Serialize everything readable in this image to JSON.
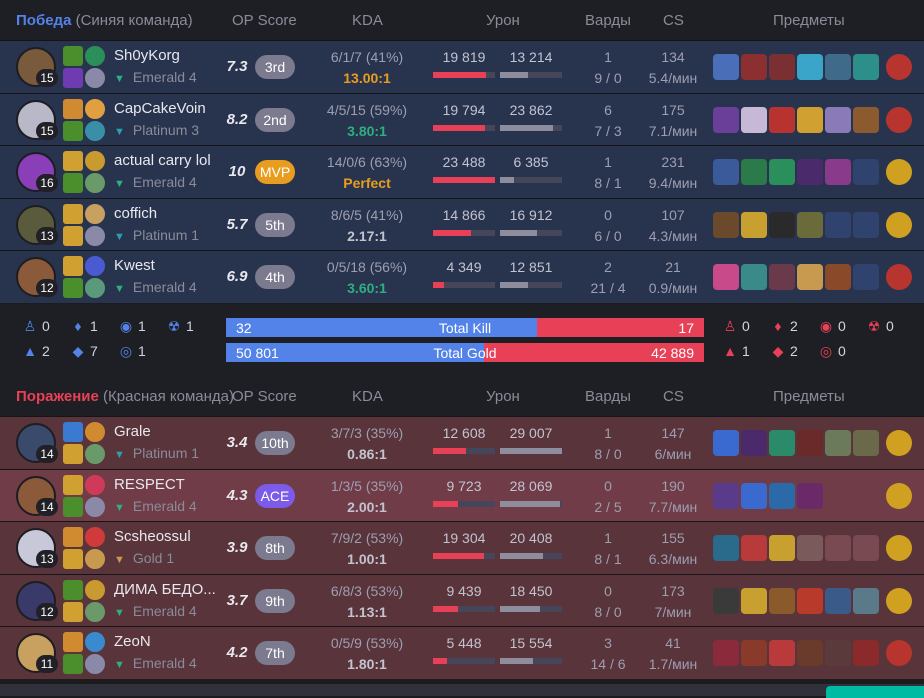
{
  "blue_team": {
    "result": "Победа",
    "side": "(Синяя команда)",
    "headers": {
      "op": "OP Score",
      "kda": "KDA",
      "damage": "Урон",
      "wards": "Варды",
      "cs": "CS",
      "items": "Предметы"
    },
    "players": [
      {
        "name": "Sh0yKorg",
        "tier": "Emerald 4",
        "tier_color": "#2daf7f",
        "level": "15",
        "op": "7.3",
        "rank": "3rd",
        "rank_type": "normal",
        "kda_line": "6/1/7 (41%)",
        "kda_ratio": "13.00:1",
        "kda_color": "#e89d20",
        "dmg_dealt": "19 819",
        "dmg_taken": "13 214",
        "dmg_dealt_frac": 0.85,
        "dmg_taken_frac": 0.45,
        "wards_placed": "1",
        "wards_kills": "9 / 0",
        "cs": "134",
        "cs_min": "5.4/мин",
        "champ_color": "#7a5a3c",
        "spells": [
          "#4a8f2b",
          "#6e3bb0"
        ],
        "runes": [
          "#2b8f5a",
          "#8a8aa8"
        ],
        "items": [
          "#4a6fb8",
          "#8b2f30",
          "#7a3033",
          "#3aa5c8",
          "#3f6a8a",
          "#2d8f8a"
        ],
        "ward_color": "#b8342f"
      },
      {
        "name": "CapCakeVoin",
        "tier": "Platinum 3",
        "tier_color": "#2d9fa8",
        "level": "15",
        "op": "8.2",
        "rank": "2nd",
        "rank_type": "normal",
        "kda_line": "4/5/15 (59%)",
        "kda_ratio": "3.80:1",
        "kda_color": "#2daf7f",
        "dmg_dealt": "19 794",
        "dmg_taken": "23 862",
        "dmg_dealt_frac": 0.84,
        "dmg_taken_frac": 0.85,
        "wards_placed": "6",
        "wards_kills": "7 / 3",
        "cs": "175",
        "cs_min": "7.1/мин",
        "champ_color": "#b8b8c8",
        "spells": [
          "#d08a30",
          "#4a8f2b"
        ],
        "runes": [
          "#e0a040",
          "#3a8fa8"
        ],
        "items": [
          "#6a3f9a",
          "#c7b8d8",
          "#b8322f",
          "#d0a030",
          "#8a7ab8",
          "#8b5a2f"
        ],
        "ward_color": "#b8342f"
      },
      {
        "name": "actual carry lol",
        "tier": "Emerald 4",
        "tier_color": "#2daf7f",
        "level": "16",
        "op": "10",
        "rank": "MVP",
        "rank_type": "mvp",
        "kda_line": "14/0/6 (63%)",
        "kda_ratio": "Perfect",
        "kda_color": "#e89d20",
        "dmg_dealt": "23 488",
        "dmg_taken": "6 385",
        "dmg_dealt_frac": 1.0,
        "dmg_taken_frac": 0.22,
        "wards_placed": "1",
        "wards_kills": "8 / 1",
        "cs": "231",
        "cs_min": "9.4/мин",
        "champ_color": "#8a3fb8",
        "spells": [
          "#d0a030",
          "#4a8f2b"
        ],
        "runes": [
          "#c89a30",
          "#6a9a6a"
        ],
        "items": [
          "#3a5a9a",
          "#2a7a4a",
          "#2a8f5a",
          "#4a2a6a",
          "#8a3a8a",
          "empty"
        ],
        "ward_color": "#d0a020"
      },
      {
        "name": "coffich",
        "tier": "Platinum 1",
        "tier_color": "#2d9fa8",
        "level": "13",
        "op": "5.7",
        "rank": "5th",
        "rank_type": "normal",
        "kda_line": "8/6/5 (41%)",
        "kda_ratio": "2.17:1",
        "kda_color": "#c3c3d0",
        "dmg_dealt": "14 866",
        "dmg_taken": "16 912",
        "dmg_dealt_frac": 0.62,
        "dmg_taken_frac": 0.6,
        "wards_placed": "0",
        "wards_kills": "6 / 0",
        "cs": "107",
        "cs_min": "4.3/мин",
        "champ_color": "#5a5a3c",
        "spells": [
          "#d0a030",
          "#d0a030"
        ],
        "runes": [
          "#c8a060",
          "#8a8aa8"
        ],
        "items": [
          "#6a4a2a",
          "#c8a030",
          "#2a2a2a",
          "#6a6a3a",
          "empty",
          "empty"
        ],
        "ward_color": "#d0a020"
      },
      {
        "name": "Kwest",
        "tier": "Emerald 4",
        "tier_color": "#2daf7f",
        "level": "12",
        "op": "6.9",
        "rank": "4th",
        "rank_type": "normal",
        "kda_line": "0/5/18 (56%)",
        "kda_ratio": "3.60:1",
        "kda_color": "#2daf7f",
        "dmg_dealt": "4 349",
        "dmg_taken": "12 851",
        "dmg_dealt_frac": 0.18,
        "dmg_taken_frac": 0.45,
        "wards_placed": "2",
        "wards_kills": "21 / 4",
        "cs": "21",
        "cs_min": "0.9/мин",
        "champ_color": "#8a5a3a",
        "spells": [
          "#d0a030",
          "#4a8f2b"
        ],
        "runes": [
          "#4a5ad0",
          "#5a9a7a"
        ],
        "items": [
          "#c84a8a",
          "#3a8a8a",
          "#6a3a4a",
          "#c89a50",
          "#8a4a2a",
          "empty"
        ],
        "ward_color": "#b8342f"
      }
    ]
  },
  "summary": {
    "blue_objectives": [
      {
        "icon": "baron-icon",
        "value": "0"
      },
      {
        "icon": "dragon-icon",
        "value": "1"
      },
      {
        "icon": "herald-icon",
        "value": "1"
      },
      {
        "icon": "grub-icon",
        "value": "1"
      },
      {
        "icon": "tower-icon",
        "value": "2"
      },
      {
        "icon": "inhibitor-icon",
        "value": "7"
      },
      {
        "icon": "atakhan-icon",
        "value": "1"
      }
    ],
    "red_objectives": [
      {
        "icon": "baron-icon",
        "value": "0"
      },
      {
        "icon": "dragon-icon",
        "value": "2"
      },
      {
        "icon": "herald-icon",
        "value": "0"
      },
      {
        "icon": "grub-icon",
        "value": "0"
      },
      {
        "icon": "tower-icon",
        "value": "1"
      },
      {
        "icon": "inhibitor-icon",
        "value": "2"
      },
      {
        "icon": "atakhan-icon",
        "value": "0"
      }
    ],
    "total_kill": {
      "label": "Total Kill",
      "blue": "32",
      "red": "17",
      "blue_frac": 0.65
    },
    "total_gold": {
      "label": "Total Gold",
      "blue": "50 801",
      "red": "42 889",
      "blue_frac": 0.54
    },
    "colors": {
      "blue": "#5383e8",
      "red": "#e84057"
    }
  },
  "red_team": {
    "result": "Поражение",
    "side": "(Красная команда)",
    "headers": {
      "op": "OP Score",
      "kda": "KDA",
      "damage": "Урон",
      "wards": "Варды",
      "cs": "CS",
      "items": "Предметы"
    },
    "players": [
      {
        "name": "Grale",
        "tier": "Platinum 1",
        "tier_color": "#2d9fa8",
        "level": "14",
        "op": "3.4",
        "rank": "10th",
        "rank_type": "normal",
        "kda_line": "3/7/3 (35%)",
        "kda_ratio": "0.86:1",
        "kda_color": "#c3c3d0",
        "dmg_dealt": "12 608",
        "dmg_taken": "29 007",
        "dmg_dealt_frac": 0.54,
        "dmg_taken_frac": 1.0,
        "wards_placed": "1",
        "wards_kills": "8 / 0",
        "cs": "147",
        "cs_min": "6/мин",
        "champ_color": "#3a4a6a",
        "spells": [
          "#3a7ad0",
          "#d0a030"
        ],
        "runes": [
          "#d08a30",
          "#6a9a6a"
        ],
        "items": [
          "#3a6ad0",
          "#4a2a6a",
          "#2a8a6a",
          "#6a2a2a",
          "#6a7a5a",
          "#6a6a4a"
        ],
        "ward_color": "#d0a020"
      },
      {
        "name": "RESPECT",
        "tier": "Emerald 4",
        "tier_color": "#2daf7f",
        "level": "14",
        "op": "4.3",
        "rank": "ACE",
        "rank_type": "ace",
        "kda_line": "1/3/5 (35%)",
        "kda_ratio": "2.00:1",
        "kda_color": "#c3c3d0",
        "dmg_dealt": "9 723",
        "dmg_taken": "28 069",
        "dmg_dealt_frac": 0.41,
        "dmg_taken_frac": 0.96,
        "wards_placed": "0",
        "wards_kills": "2 / 5",
        "cs": "190",
        "cs_min": "7.7/мин",
        "champ_color": "#8a5a3a",
        "spells": [
          "#d0a030",
          "#4a8f2b"
        ],
        "runes": [
          "#d03a5a",
          "#8a8aa8"
        ],
        "items": [
          "#5a3a8a",
          "#3a6ad0",
          "#2a6aa8",
          "#6a2a6a",
          "none",
          "none"
        ],
        "ward_color": "#d0a020"
      },
      {
        "name": "Scsheossul",
        "tier": "Gold 1",
        "tier_color": "#c89a50",
        "level": "13",
        "op": "3.9",
        "rank": "8th",
        "rank_type": "normal",
        "kda_line": "7/9/2 (53%)",
        "kda_ratio": "1.00:1",
        "kda_color": "#c3c3d0",
        "dmg_dealt": "19 304",
        "dmg_taken": "20 408",
        "dmg_dealt_frac": 0.82,
        "dmg_taken_frac": 0.7,
        "wards_placed": "1",
        "wards_kills": "8 / 1",
        "cs": "155",
        "cs_min": "6.3/мин",
        "champ_color": "#c8c8d8",
        "spells": [
          "#d08a30",
          "#d0a030"
        ],
        "runes": [
          "#d03a3a",
          "#c89a50"
        ],
        "items": [
          "#2a6a8a",
          "#b83a3a",
          "#c8a030",
          "#7a5a5a",
          "empty",
          "empty"
        ],
        "ward_color": "#d0a020"
      },
      {
        "name": "ДИМА БЕДО...",
        "tier": "Emerald 4",
        "tier_color": "#2daf7f",
        "level": "12",
        "op": "3.7",
        "rank": "9th",
        "rank_type": "normal",
        "kda_line": "6/8/3 (53%)",
        "kda_ratio": "1.13:1",
        "kda_color": "#c3c3d0",
        "dmg_dealt": "9 439",
        "dmg_taken": "18 450",
        "dmg_dealt_frac": 0.4,
        "dmg_taken_frac": 0.64,
        "wards_placed": "0",
        "wards_kills": "8 / 0",
        "cs": "173",
        "cs_min": "7/мин",
        "champ_color": "#3a3a6a",
        "spells": [
          "#4a8f2b",
          "#d0a030"
        ],
        "runes": [
          "#c89a30",
          "#6a9a6a"
        ],
        "items": [
          "#3a3a3a",
          "#c8a030",
          "#8a5a2a",
          "#b83a2a",
          "#3a5a8a",
          "#5a7a8a"
        ],
        "ward_color": "#d0a020"
      },
      {
        "name": "ZeoN",
        "tier": "Emerald 4",
        "tier_color": "#2daf7f",
        "level": "11",
        "op": "4.2",
        "rank": "7th",
        "rank_type": "normal",
        "kda_line": "0/5/9 (53%)",
        "kda_ratio": "1.80:1",
        "kda_color": "#c3c3d0",
        "dmg_dealt": "5 448",
        "dmg_taken": "15 554",
        "dmg_dealt_frac": 0.23,
        "dmg_taken_frac": 0.54,
        "wards_placed": "3",
        "wards_kills": "14 / 6",
        "cs": "41",
        "cs_min": "1.7/мин",
        "champ_color": "#c8a060",
        "spells": [
          "#d08a30",
          "#4a8f2b"
        ],
        "runes": [
          "#3a8ad0",
          "#8a8aa8"
        ],
        "items": [
          "#8a2a3a",
          "#8a3a2a",
          "#b83a3a",
          "#6a3a2a",
          "#5a3a3a",
          "#8a2a2a"
        ],
        "ward_color": "#b8342f"
      }
    ]
  }
}
